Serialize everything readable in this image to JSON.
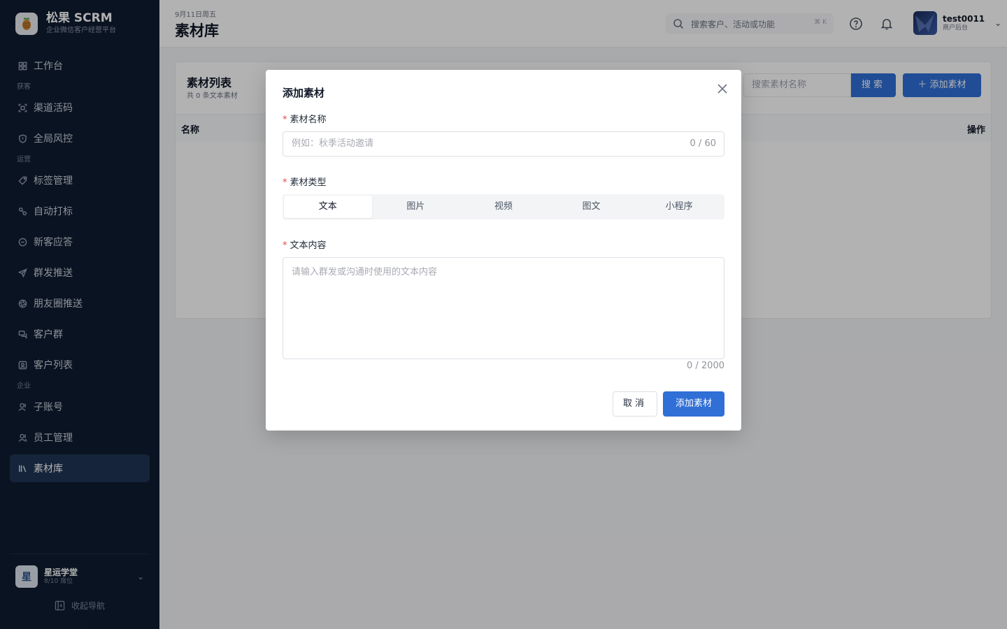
{
  "brand": {
    "name": "松果 SCRM",
    "subtitle": "企业微信客户经营平台"
  },
  "sidebar": {
    "items": [
      {
        "type": "item",
        "label": "工作台",
        "icon": "grid-icon"
      },
      {
        "type": "group",
        "label": "获客"
      },
      {
        "type": "item",
        "label": "渠道活码",
        "icon": "scan-icon"
      },
      {
        "type": "item",
        "label": "全局风控",
        "icon": "shield-icon"
      },
      {
        "type": "group",
        "label": "运营"
      },
      {
        "type": "item",
        "label": "标签管理",
        "icon": "tag-icon"
      },
      {
        "type": "item",
        "label": "自动打标",
        "icon": "link-icon"
      },
      {
        "type": "item",
        "label": "新客应答",
        "icon": "chat-icon"
      },
      {
        "type": "item",
        "label": "群发推送",
        "icon": "send-icon"
      },
      {
        "type": "item",
        "label": "朋友圈推送",
        "icon": "aperture-icon"
      },
      {
        "type": "item",
        "label": "客户群",
        "icon": "group-chat-icon"
      },
      {
        "type": "item",
        "label": "客户列表",
        "icon": "contact-icon"
      },
      {
        "type": "group",
        "label": "企业"
      },
      {
        "type": "item",
        "label": "子账号",
        "icon": "user-icon"
      },
      {
        "type": "item",
        "label": "员工管理",
        "icon": "users-icon"
      },
      {
        "type": "item",
        "label": "素材库",
        "icon": "library-icon",
        "active": true
      }
    ],
    "org": {
      "avatar": "星",
      "name": "星运学堂",
      "seats": "8/10 席位"
    },
    "collapse_label": "收起导航"
  },
  "header": {
    "date": "9月11日周五",
    "title": "素材库",
    "search_placeholder": "搜索客户、活动或功能",
    "shortcut": "⌘ K",
    "user": {
      "name": "test0011",
      "role": "商户后台"
    }
  },
  "card": {
    "title": "素材列表",
    "subtitle": "共 0 条文本素材",
    "search_placeholder": "搜索素材名称",
    "search_button": "搜索",
    "add_button": "＋ 添加素材",
    "columns": {
      "name": "名称",
      "actions": "操作"
    }
  },
  "modal": {
    "title": "添加素材",
    "name_label": "素材名称",
    "name_placeholder": "例如：秋季活动邀请",
    "name_counter": "0 / 60",
    "type_label": "素材类型",
    "types": [
      "文本",
      "图片",
      "视频",
      "图文",
      "小程序"
    ],
    "selected_type": "文本",
    "content_label": "文本内容",
    "content_placeholder": "请输入群发或沟通时使用的文本内容",
    "content_counter": "0 / 2000",
    "cancel": "取消",
    "submit": "添加素材"
  },
  "colors": {
    "primary": "#2f6fd6",
    "sidebar_bg": "#0f1c30",
    "required": "#e34848"
  }
}
